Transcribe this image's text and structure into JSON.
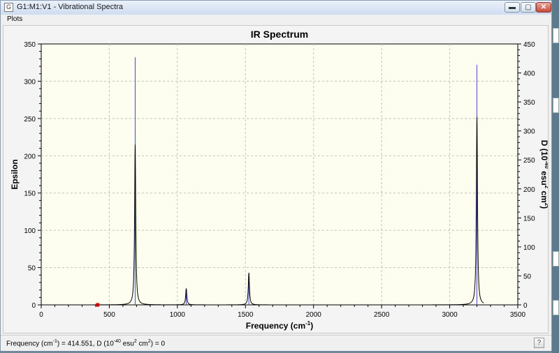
{
  "window": {
    "title": "G1:M1:V1 - Vibrational Spectra",
    "app_icon_glyph": "G",
    "minimize_glyph": "▬",
    "maximize_glyph": "▢",
    "close_glyph": "✕"
  },
  "menu": {
    "items": [
      "Plots"
    ]
  },
  "status": {
    "text_before_sup1": "Frequency (cm",
    "sup1": "-1",
    "text_mid": ") = 414.551, D (10",
    "sup2": "-40",
    "text_mid2": " esu",
    "sup3": "2",
    "text_mid3": " cm",
    "sup4": "2",
    "text_end": ") = 0",
    "help_glyph": "?"
  },
  "colors": {
    "plot_background": "#fdfdf0",
    "spectrum_line": "#000000",
    "stick_line": "#4a4ad0",
    "cursor_marker": "#cc0000"
  },
  "chart_data": {
    "type": "line",
    "title": "IR Spectrum",
    "xlabel": "Frequency (cm-1)",
    "xlabel_main": "Frequency (cm",
    "xlabel_sup": "-1",
    "xlabel_close": ")",
    "ylabel": "Epsilon",
    "y2label_parts": {
      "a": "D (10",
      "sup1": "-40",
      "b": " esu",
      "sup2": "2",
      "c": " cm",
      "sup3": "2",
      "d": ")"
    },
    "xlim": [
      0,
      3500
    ],
    "ylim": [
      0,
      350
    ],
    "y2lim": [
      0,
      450
    ],
    "x_ticks": [
      0,
      500,
      1000,
      1500,
      2000,
      2500,
      3000,
      3500
    ],
    "y_ticks": [
      0,
      50,
      100,
      150,
      200,
      250,
      300,
      350
    ],
    "y2_ticks": [
      0,
      50,
      100,
      150,
      200,
      250,
      300,
      350,
      400,
      450
    ],
    "grid": true,
    "cursor_x": 414.551,
    "peaks": [
      {
        "x": 690,
        "epsilon": 215,
        "d_stick": 427
      },
      {
        "x": 1065,
        "epsilon": 22,
        "d_stick": 20
      },
      {
        "x": 1525,
        "epsilon": 43,
        "d_stick": 40
      },
      {
        "x": 3200,
        "epsilon": 252,
        "d_stick": 414
      }
    ]
  }
}
